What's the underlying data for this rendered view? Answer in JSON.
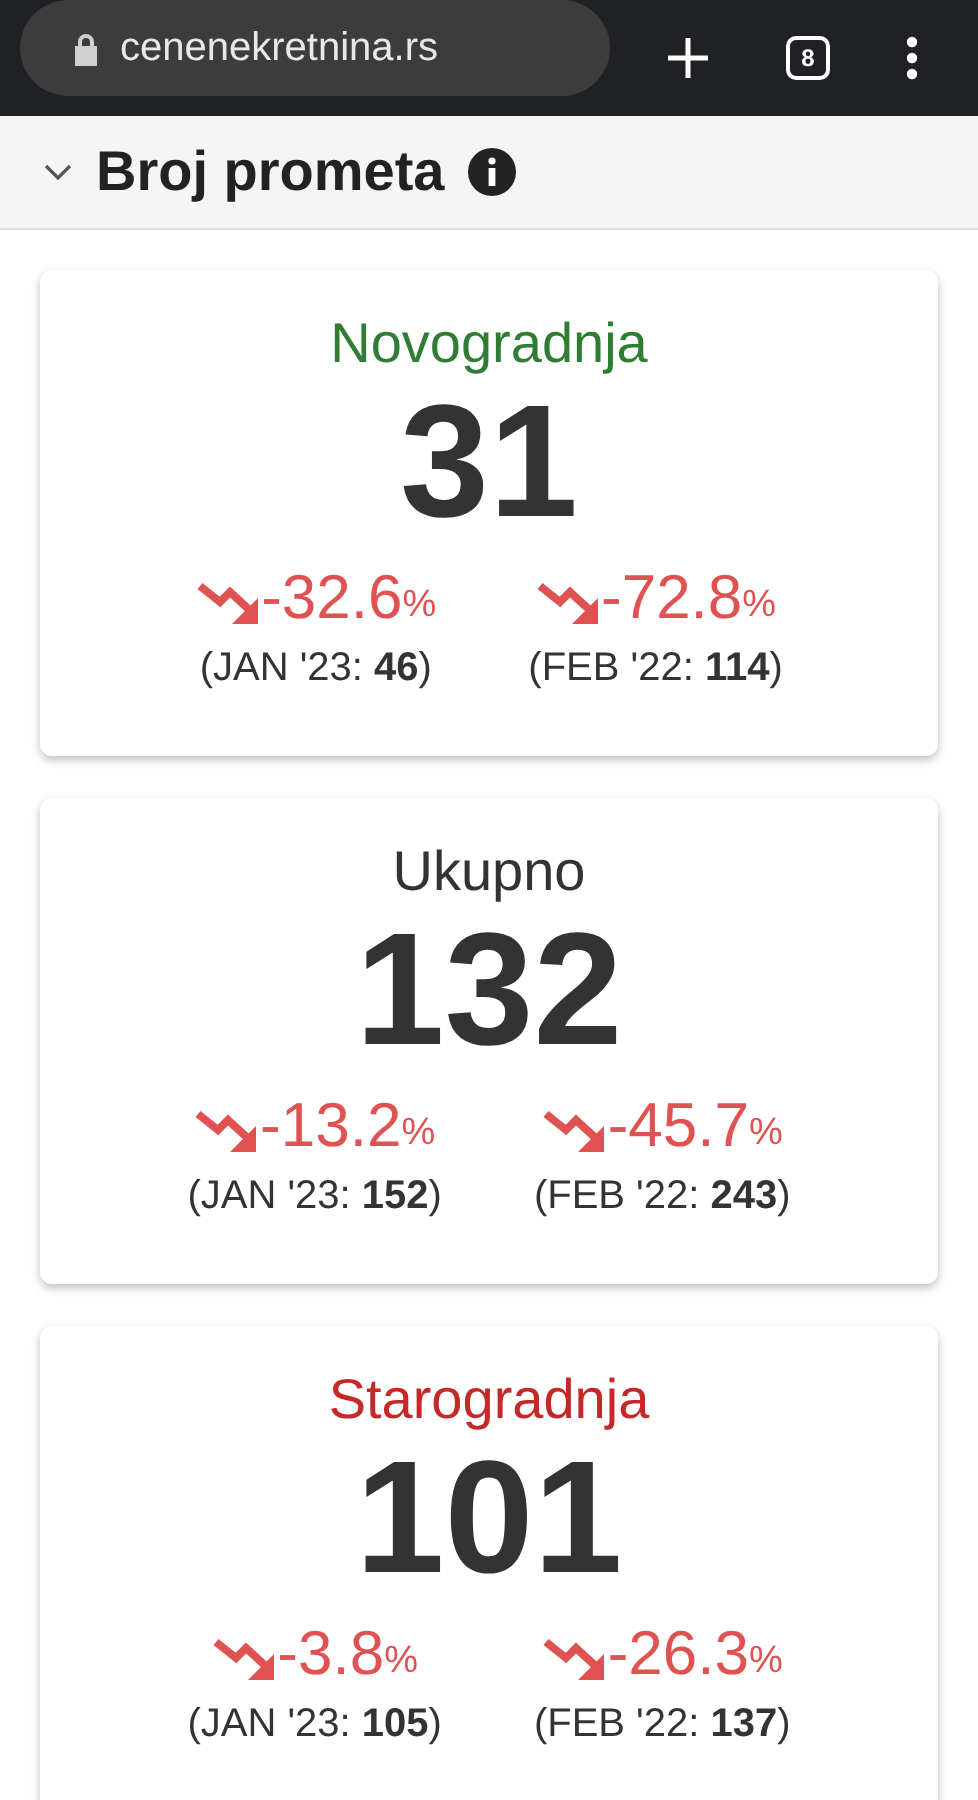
{
  "browser": {
    "url": "cenenekretnina.rs",
    "tab_count": "8"
  },
  "section": {
    "title": "Broj prometa",
    "expanded": true
  },
  "cards": [
    {
      "title": "Novogradnja",
      "color": "#2e7d32",
      "count": "31",
      "changes": [
        {
          "kind": "down",
          "value": "-32.6",
          "unit": "%",
          "reference": "(JAN '23: **46**)"
        },
        {
          "kind": "down",
          "value": "-72.8",
          "unit": "%",
          "reference": "(FEB '22: **114**)"
        }
      ]
    },
    {
      "title": "Ukupno",
      "color": "#333333",
      "count": "132",
      "changes": [
        {
          "kind": "down",
          "value": "-13.2",
          "unit": "%",
          "reference": "(JAN '23: **152**)"
        },
        {
          "kind": "down",
          "value": "-45.7",
          "unit": "%",
          "reference": "(FEB '22: **243**)"
        }
      ]
    },
    {
      "title": "Starogradnja",
      "color": "#c62828",
      "count": "101",
      "changes": [
        {
          "kind": "down",
          "value": "-3.8",
          "unit": "%",
          "reference": "(JAN '23: **105**)"
        },
        {
          "kind": "down",
          "value": "-26.3",
          "unit": "%",
          "reference": "(FEB '22: **137**)"
        }
      ]
    }
  ]
}
